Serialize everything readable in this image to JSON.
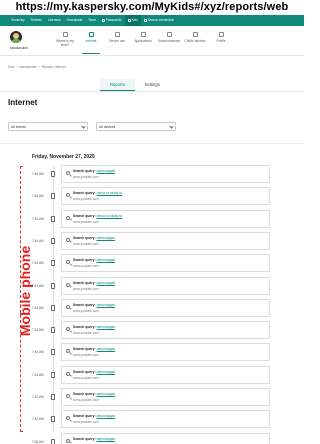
{
  "url_banner": "https://my.kaspersky.com/MyKids#/xyz/reports/web",
  "topnav": {
    "items": [
      "Summary",
      "Devices",
      "Licenses",
      "Downloads",
      "Store",
      "Passwords",
      "Kids",
      "Secure connection"
    ],
    "active": "Kids"
  },
  "subnav": {
    "profile_name": "kasukasukid",
    "tabs": [
      "Where is my child?",
      "Internet",
      "Device use",
      "Applications",
      "Social networks",
      "Child's devices",
      "Profile"
    ],
    "active": "Internet"
  },
  "breadcrumb": [
    "Kids",
    "kasukasukid",
    "Reports: Internet"
  ],
  "tabs": [
    "Reports",
    "Settings"
  ],
  "active_tab": "Reports",
  "page_title": "Internet",
  "filters": {
    "events": "All events",
    "devices": "All devices"
  },
  "date_heading": "Friday, November 27, 2020",
  "side_label": "Mobile phone",
  "query_label": "Search query:",
  "entries": [
    {
      "time": "7:45 AM",
      "query": "astrozapgas",
      "site": "www.youtube.com"
    },
    {
      "time": "7:45 AM",
      "query": "music to study to",
      "site": "www.youtube.com"
    },
    {
      "time": "7:44 AM",
      "query": "music to study to",
      "site": "www.youtube.com"
    },
    {
      "time": "7:44 AM",
      "query": "astrozapgas",
      "site": "www.youtube.com"
    },
    {
      "time": "7:44 AM",
      "query": "astrozapgas",
      "site": "www.youtube.com"
    },
    {
      "time": "7:44 AM",
      "query": "astrozapgas",
      "site": "www.youtube.com"
    },
    {
      "time": "7:44 AM",
      "query": "astrozapgas",
      "site": "www.youtube.com"
    },
    {
      "time": "7:43 AM",
      "query": "astrozapgas",
      "site": "www.youtube.com"
    },
    {
      "time": "7:43 AM",
      "query": "astrozapgas",
      "site": "www.youtube.com"
    },
    {
      "time": "7:43 AM",
      "query": "astrozapgas",
      "site": "www.youtube.com"
    },
    {
      "time": "7:42 AM",
      "query": "astrozapgas",
      "site": "www.youtube.com"
    },
    {
      "time": "7:42 AM",
      "query": "astrozapgas",
      "site": "www.youtube.com"
    },
    {
      "time": "7:06 AM",
      "query": "astrozapgas",
      "site": "www.youtube.com"
    }
  ]
}
